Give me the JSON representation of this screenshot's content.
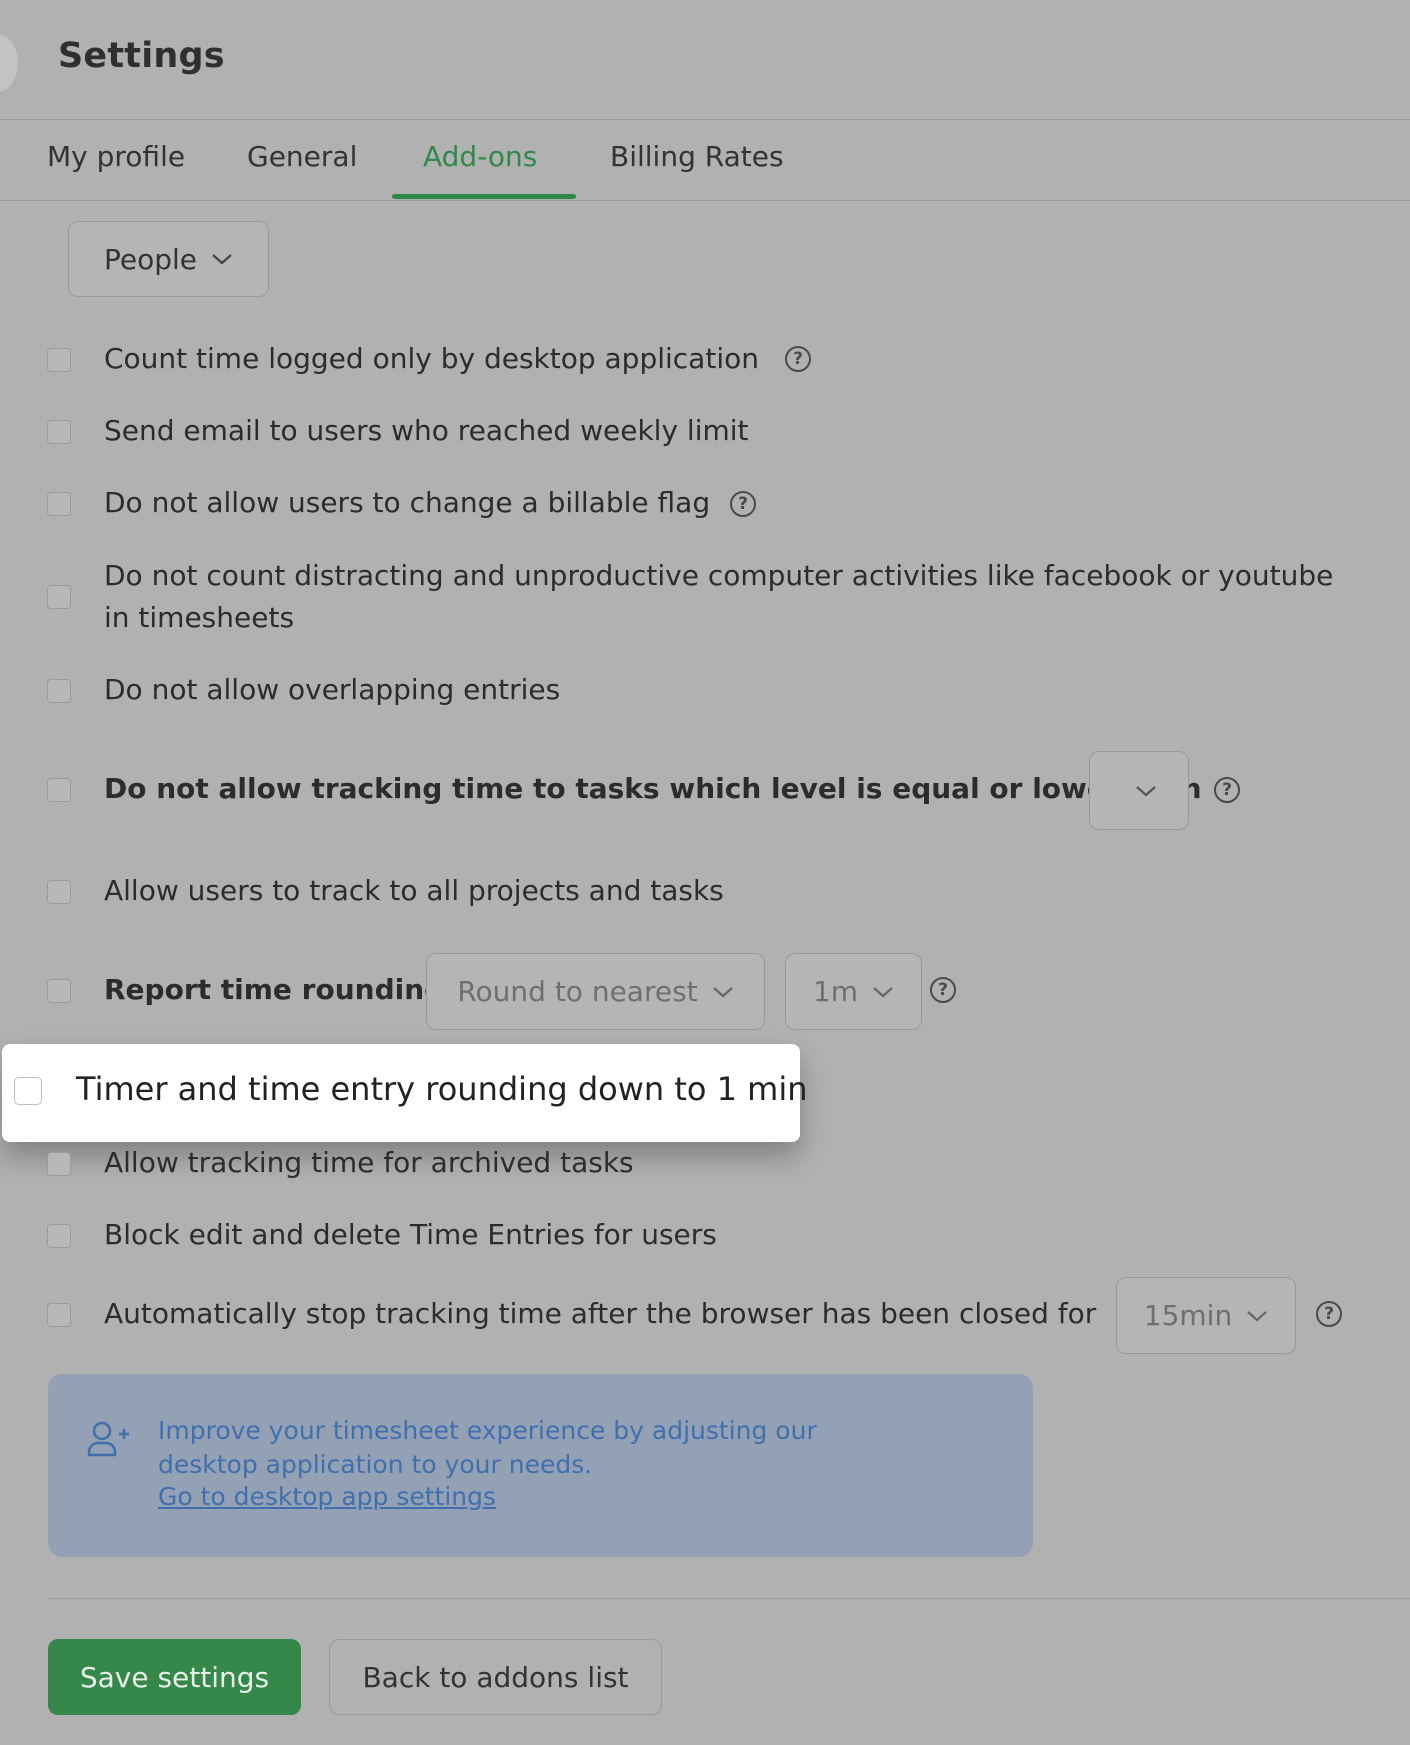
{
  "header": {
    "title": "Settings"
  },
  "tabs": [
    {
      "label": "My profile"
    },
    {
      "label": "General"
    },
    {
      "label": "Add-ons",
      "active": true
    },
    {
      "label": "Billing Rates"
    }
  ],
  "filter": {
    "selected": "People"
  },
  "options": [
    {
      "label": "Count time logged only by desktop application",
      "checked": false,
      "help": true
    },
    {
      "label": "Send email to users who reached weekly limit",
      "checked": false
    },
    {
      "label": "Do not allow users to change a billable flag",
      "checked": false,
      "help": true
    },
    {
      "label": "Do not count distracting and unproductive computer activities like facebook or youtube in timesheets",
      "checked": false
    },
    {
      "label": "Do not allow overlapping entries",
      "checked": false
    },
    {
      "label": "Do not allow tracking time to tasks which level is equal or lower than",
      "checked": false,
      "select_value": "",
      "help": true
    },
    {
      "label": "Allow users to track to all projects and tasks",
      "checked": false
    },
    {
      "label": "Report time rounding",
      "checked": false,
      "rounding_mode": "Round to nearest",
      "rounding_interval": "1m",
      "help": true
    },
    {
      "label": "Timer and time entry rounding down to 1 min",
      "checked": false,
      "highlighted": true
    },
    {
      "label": "Allow tracking time for archived tasks",
      "checked": false
    },
    {
      "label": "Block edit and delete Time Entries for users",
      "checked": false
    },
    {
      "label": "Automatically stop tracking time after the browser has been closed for",
      "checked": false,
      "select_value": "15min",
      "help": true
    }
  ],
  "info": {
    "text": "Improve your timesheet experience by adjusting our desktop application to your needs.",
    "link": "Go to desktop app settings",
    "icon": "add-user-icon"
  },
  "actions": {
    "save": "Save settings",
    "back": "Back to addons list"
  },
  "colors": {
    "accent": "#2f8a4a",
    "info_text": "#3f6fae",
    "save_bg": "#35874a"
  }
}
